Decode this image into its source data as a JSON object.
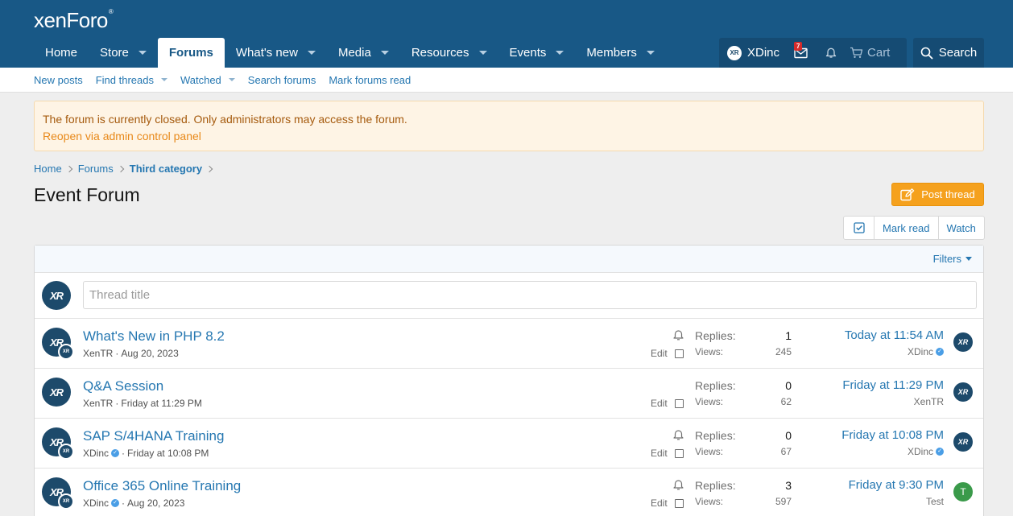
{
  "brand": {
    "logo_text": "xenForo",
    "logo_mark": "®"
  },
  "nav": {
    "tabs": [
      {
        "label": "Home",
        "has_menu": false,
        "active": false
      },
      {
        "label": "Store",
        "has_menu": true,
        "active": false
      },
      {
        "label": "Forums",
        "has_menu": false,
        "active": true
      },
      {
        "label": "What's new",
        "has_menu": true,
        "active": false
      },
      {
        "label": "Media",
        "has_menu": true,
        "active": false
      },
      {
        "label": "Resources",
        "has_menu": true,
        "active": false
      },
      {
        "label": "Events",
        "has_menu": true,
        "active": false
      },
      {
        "label": "Members",
        "has_menu": true,
        "active": false
      }
    ],
    "account_name": "XDinc",
    "account_avatar_text": "XR",
    "inbox_badge": "7",
    "cart_label": "Cart",
    "search_label": "Search"
  },
  "subnav": {
    "items": [
      {
        "label": "New posts",
        "has_menu": false
      },
      {
        "label": "Find threads",
        "has_menu": true
      },
      {
        "label": "Watched",
        "has_menu": true
      },
      {
        "label": "Search forums",
        "has_menu": false
      },
      {
        "label": "Mark forums read",
        "has_menu": false
      }
    ]
  },
  "notice": {
    "text": "The forum is currently closed. Only administrators may access the forum.",
    "link": "Reopen via admin control panel"
  },
  "breadcrumb": {
    "items": [
      "Home",
      "Forums",
      "Third category"
    ]
  },
  "page": {
    "title": "Event Forum",
    "post_thread_label": "Post thread",
    "mark_read_label": "Mark read",
    "watch_label": "Watch"
  },
  "list": {
    "filters_label": "Filters",
    "thread_title_placeholder": "Thread title",
    "threads": [
      {
        "title": "What's New in PHP 8.2",
        "author": "XenTR",
        "author_verified": false,
        "date": "Aug 20, 2023",
        "watched": true,
        "edit_label": "Edit",
        "replies_label": "Replies:",
        "replies": "1",
        "views_label": "Views:",
        "views": "245",
        "last_date": "Today at 11:54 AM",
        "last_user": "XDinc",
        "last_user_verified": true,
        "avatar_text": "XR",
        "has_sub_avatar": true,
        "last_avatar_text": "XR",
        "last_avatar_color": "#1d4a6b"
      },
      {
        "title": "Q&A Session",
        "author": "XenTR",
        "author_verified": false,
        "date": "Friday at 11:29 PM",
        "watched": false,
        "edit_label": "Edit",
        "replies_label": "Replies:",
        "replies": "0",
        "views_label": "Views:",
        "views": "62",
        "last_date": "Friday at 11:29 PM",
        "last_user": "XenTR",
        "last_user_verified": false,
        "avatar_text": "XR",
        "has_sub_avatar": false,
        "last_avatar_text": "XR",
        "last_avatar_color": "#1d4a6b"
      },
      {
        "title": "SAP S/4HANA Training",
        "author": "XDinc",
        "author_verified": true,
        "date": "Friday at 10:08 PM",
        "watched": true,
        "edit_label": "Edit",
        "replies_label": "Replies:",
        "replies": "0",
        "views_label": "Views:",
        "views": "67",
        "last_date": "Friday at 10:08 PM",
        "last_user": "XDinc",
        "last_user_verified": true,
        "avatar_text": "XR",
        "has_sub_avatar": true,
        "last_avatar_text": "XR",
        "last_avatar_color": "#1d4a6b"
      },
      {
        "title": "Office 365 Online Training",
        "author": "XDinc",
        "author_verified": true,
        "date": "Aug 20, 2023",
        "watched": true,
        "edit_label": "Edit",
        "replies_label": "Replies:",
        "replies": "3",
        "views_label": "Views:",
        "views": "597",
        "last_date": "Friday at 9:30 PM",
        "last_user": "Test",
        "last_user_verified": false,
        "avatar_text": "XR",
        "has_sub_avatar": true,
        "last_avatar_text": "T",
        "last_avatar_color": "#3a9a4a"
      }
    ]
  }
}
